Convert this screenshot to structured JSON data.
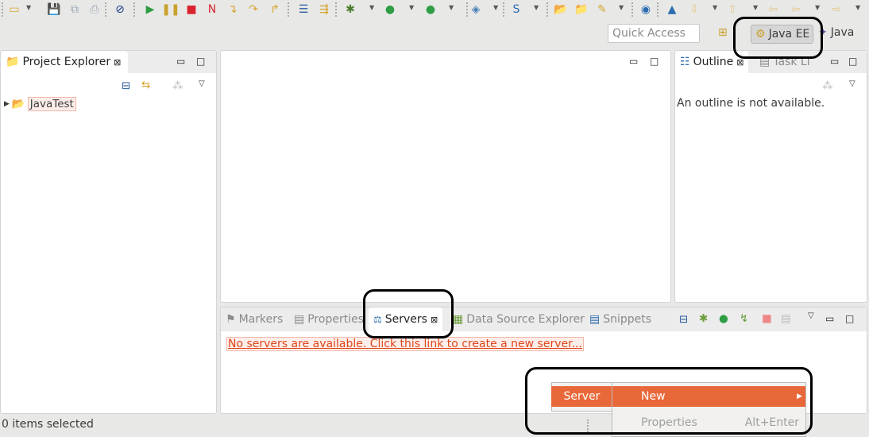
{
  "toolbar": {
    "icons": [
      {
        "name": "new-icon",
        "glyph": "▭",
        "color": "#d7a531"
      },
      {
        "name": "save-icon",
        "glyph": "💾",
        "color": "#9aa7b8"
      },
      {
        "name": "save-all-icon",
        "glyph": "⧉",
        "color": "#9aa7b8"
      },
      {
        "name": "print-icon",
        "glyph": "⎙",
        "color": "#9aa7b8"
      },
      {
        "name": "skip-breakpoints-icon",
        "glyph": "⊘",
        "color": "#1e3a8a"
      },
      {
        "name": "resume-icon",
        "glyph": "▶",
        "color": "#2e9d44"
      },
      {
        "name": "suspend-icon",
        "glyph": "❚❚",
        "color": "#c9a02a"
      },
      {
        "name": "terminate-icon",
        "glyph": "■",
        "color": "#d9232e"
      },
      {
        "name": "disconnect-icon",
        "glyph": "N",
        "color": "#d9232e"
      },
      {
        "name": "step-into-icon",
        "glyph": "↴",
        "color": "#d7a531"
      },
      {
        "name": "step-over-icon",
        "glyph": "↷",
        "color": "#d7a531"
      },
      {
        "name": "step-return-icon",
        "glyph": "↱",
        "color": "#d7a531"
      },
      {
        "name": "drop-to-frame-icon",
        "glyph": "☰",
        "color": "#2b5b9c"
      },
      {
        "name": "use-step-filters-icon",
        "glyph": "⇶",
        "color": "#d7a531"
      },
      {
        "name": "debug-icon",
        "glyph": "✱",
        "color": "#4a7d2c"
      },
      {
        "name": "run-icon",
        "glyph": "●",
        "color": "#2e9d44"
      },
      {
        "name": "run-external-icon",
        "glyph": "●",
        "color": "#2e9d44"
      },
      {
        "name": "new-server-icon",
        "glyph": "◈",
        "color": "#4a7fb8"
      },
      {
        "name": "new-web-service-icon",
        "glyph": "S",
        "color": "#2b6cb0"
      },
      {
        "name": "open-type-icon",
        "glyph": "📂",
        "color": "#d7a531"
      },
      {
        "name": "open-folder-icon",
        "glyph": "📁",
        "color": "#d7a531"
      },
      {
        "name": "search-icon",
        "glyph": "✎",
        "color": "#d7a531"
      },
      {
        "name": "globe-icon",
        "glyph": "◉",
        "color": "#2b6cb0"
      },
      {
        "name": "run-web-icon",
        "glyph": "▲",
        "color": "#2b6cb0"
      },
      {
        "name": "next-annotation-icon",
        "glyph": "⇩",
        "color": "#e5c88a"
      },
      {
        "name": "previous-annotation-icon",
        "glyph": "⇧",
        "color": "#e5c88a"
      },
      {
        "name": "last-edit-icon",
        "glyph": "⇦",
        "color": "#e5c88a"
      },
      {
        "name": "back-icon",
        "glyph": "⇦",
        "color": "#e5c88a"
      },
      {
        "name": "forward-icon",
        "glyph": "⇨",
        "color": "#e5c88a"
      }
    ],
    "quick_access_placeholder": "Quick Access",
    "perspectives": [
      {
        "label": "Java EE",
        "active": true
      },
      {
        "label": "Java",
        "active": false
      }
    ]
  },
  "project_explorer": {
    "title": "Project Explorer",
    "items": [
      {
        "label": "JavaTest"
      }
    ]
  },
  "outline": {
    "tabs": [
      "Outline",
      "Task Li"
    ],
    "message": "An outline is not available."
  },
  "bottom": {
    "tabs": [
      "Markers",
      "Properties",
      "Servers",
      "Data Source Explorer",
      "Snippets"
    ],
    "active": "Servers",
    "link": "No servers are available. Click this link to create a new server..."
  },
  "context_menu": {
    "parent": "Server",
    "items": [
      {
        "label": "New",
        "shortcut": "",
        "highlighted": true,
        "submenu": true
      },
      {
        "label": "Properties",
        "shortcut": "Alt+Enter",
        "highlighted": false,
        "disabled": true
      }
    ]
  },
  "status": {
    "text": "0 items selected"
  },
  "colors": {
    "accent": "#e9683a",
    "link": "#e0471b"
  }
}
